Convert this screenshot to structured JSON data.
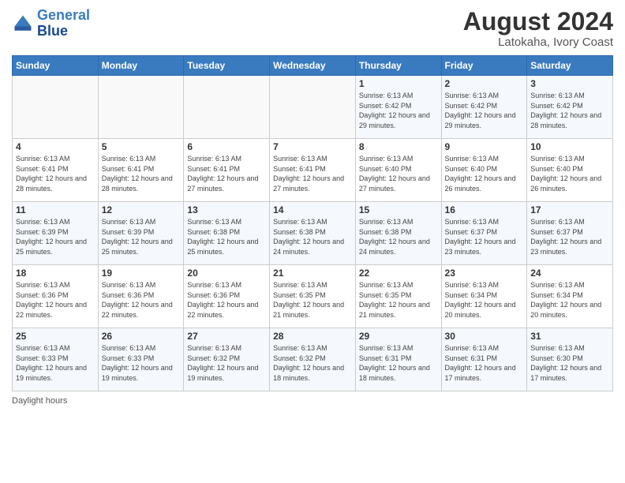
{
  "logo": {
    "line1": "General",
    "line2": "Blue"
  },
  "title": "August 2024",
  "location": "Latokaha, Ivory Coast",
  "days_of_week": [
    "Sunday",
    "Monday",
    "Tuesday",
    "Wednesday",
    "Thursday",
    "Friday",
    "Saturday"
  ],
  "footer_text": "Daylight hours",
  "weeks": [
    [
      {
        "day": "",
        "info": ""
      },
      {
        "day": "",
        "info": ""
      },
      {
        "day": "",
        "info": ""
      },
      {
        "day": "",
        "info": ""
      },
      {
        "day": "1",
        "info": "Sunrise: 6:13 AM\nSunset: 6:42 PM\nDaylight: 12 hours\nand 29 minutes."
      },
      {
        "day": "2",
        "info": "Sunrise: 6:13 AM\nSunset: 6:42 PM\nDaylight: 12 hours\nand 29 minutes."
      },
      {
        "day": "3",
        "info": "Sunrise: 6:13 AM\nSunset: 6:42 PM\nDaylight: 12 hours\nand 28 minutes."
      }
    ],
    [
      {
        "day": "4",
        "info": "Sunrise: 6:13 AM\nSunset: 6:41 PM\nDaylight: 12 hours\nand 28 minutes."
      },
      {
        "day": "5",
        "info": "Sunrise: 6:13 AM\nSunset: 6:41 PM\nDaylight: 12 hours\nand 28 minutes."
      },
      {
        "day": "6",
        "info": "Sunrise: 6:13 AM\nSunset: 6:41 PM\nDaylight: 12 hours\nand 27 minutes."
      },
      {
        "day": "7",
        "info": "Sunrise: 6:13 AM\nSunset: 6:41 PM\nDaylight: 12 hours\nand 27 minutes."
      },
      {
        "day": "8",
        "info": "Sunrise: 6:13 AM\nSunset: 6:40 PM\nDaylight: 12 hours\nand 27 minutes."
      },
      {
        "day": "9",
        "info": "Sunrise: 6:13 AM\nSunset: 6:40 PM\nDaylight: 12 hours\nand 26 minutes."
      },
      {
        "day": "10",
        "info": "Sunrise: 6:13 AM\nSunset: 6:40 PM\nDaylight: 12 hours\nand 26 minutes."
      }
    ],
    [
      {
        "day": "11",
        "info": "Sunrise: 6:13 AM\nSunset: 6:39 PM\nDaylight: 12 hours\nand 25 minutes."
      },
      {
        "day": "12",
        "info": "Sunrise: 6:13 AM\nSunset: 6:39 PM\nDaylight: 12 hours\nand 25 minutes."
      },
      {
        "day": "13",
        "info": "Sunrise: 6:13 AM\nSunset: 6:38 PM\nDaylight: 12 hours\nand 25 minutes."
      },
      {
        "day": "14",
        "info": "Sunrise: 6:13 AM\nSunset: 6:38 PM\nDaylight: 12 hours\nand 24 minutes."
      },
      {
        "day": "15",
        "info": "Sunrise: 6:13 AM\nSunset: 6:38 PM\nDaylight: 12 hours\nand 24 minutes."
      },
      {
        "day": "16",
        "info": "Sunrise: 6:13 AM\nSunset: 6:37 PM\nDaylight: 12 hours\nand 23 minutes."
      },
      {
        "day": "17",
        "info": "Sunrise: 6:13 AM\nSunset: 6:37 PM\nDaylight: 12 hours\nand 23 minutes."
      }
    ],
    [
      {
        "day": "18",
        "info": "Sunrise: 6:13 AM\nSunset: 6:36 PM\nDaylight: 12 hours\nand 22 minutes."
      },
      {
        "day": "19",
        "info": "Sunrise: 6:13 AM\nSunset: 6:36 PM\nDaylight: 12 hours\nand 22 minutes."
      },
      {
        "day": "20",
        "info": "Sunrise: 6:13 AM\nSunset: 6:36 PM\nDaylight: 12 hours\nand 22 minutes."
      },
      {
        "day": "21",
        "info": "Sunrise: 6:13 AM\nSunset: 6:35 PM\nDaylight: 12 hours\nand 21 minutes."
      },
      {
        "day": "22",
        "info": "Sunrise: 6:13 AM\nSunset: 6:35 PM\nDaylight: 12 hours\nand 21 minutes."
      },
      {
        "day": "23",
        "info": "Sunrise: 6:13 AM\nSunset: 6:34 PM\nDaylight: 12 hours\nand 20 minutes."
      },
      {
        "day": "24",
        "info": "Sunrise: 6:13 AM\nSunset: 6:34 PM\nDaylight: 12 hours\nand 20 minutes."
      }
    ],
    [
      {
        "day": "25",
        "info": "Sunrise: 6:13 AM\nSunset: 6:33 PM\nDaylight: 12 hours\nand 19 minutes."
      },
      {
        "day": "26",
        "info": "Sunrise: 6:13 AM\nSunset: 6:33 PM\nDaylight: 12 hours\nand 19 minutes."
      },
      {
        "day": "27",
        "info": "Sunrise: 6:13 AM\nSunset: 6:32 PM\nDaylight: 12 hours\nand 19 minutes."
      },
      {
        "day": "28",
        "info": "Sunrise: 6:13 AM\nSunset: 6:32 PM\nDaylight: 12 hours\nand 18 minutes."
      },
      {
        "day": "29",
        "info": "Sunrise: 6:13 AM\nSunset: 6:31 PM\nDaylight: 12 hours\nand 18 minutes."
      },
      {
        "day": "30",
        "info": "Sunrise: 6:13 AM\nSunset: 6:31 PM\nDaylight: 12 hours\nand 17 minutes."
      },
      {
        "day": "31",
        "info": "Sunrise: 6:13 AM\nSunset: 6:30 PM\nDaylight: 12 hours\nand 17 minutes."
      }
    ]
  ]
}
